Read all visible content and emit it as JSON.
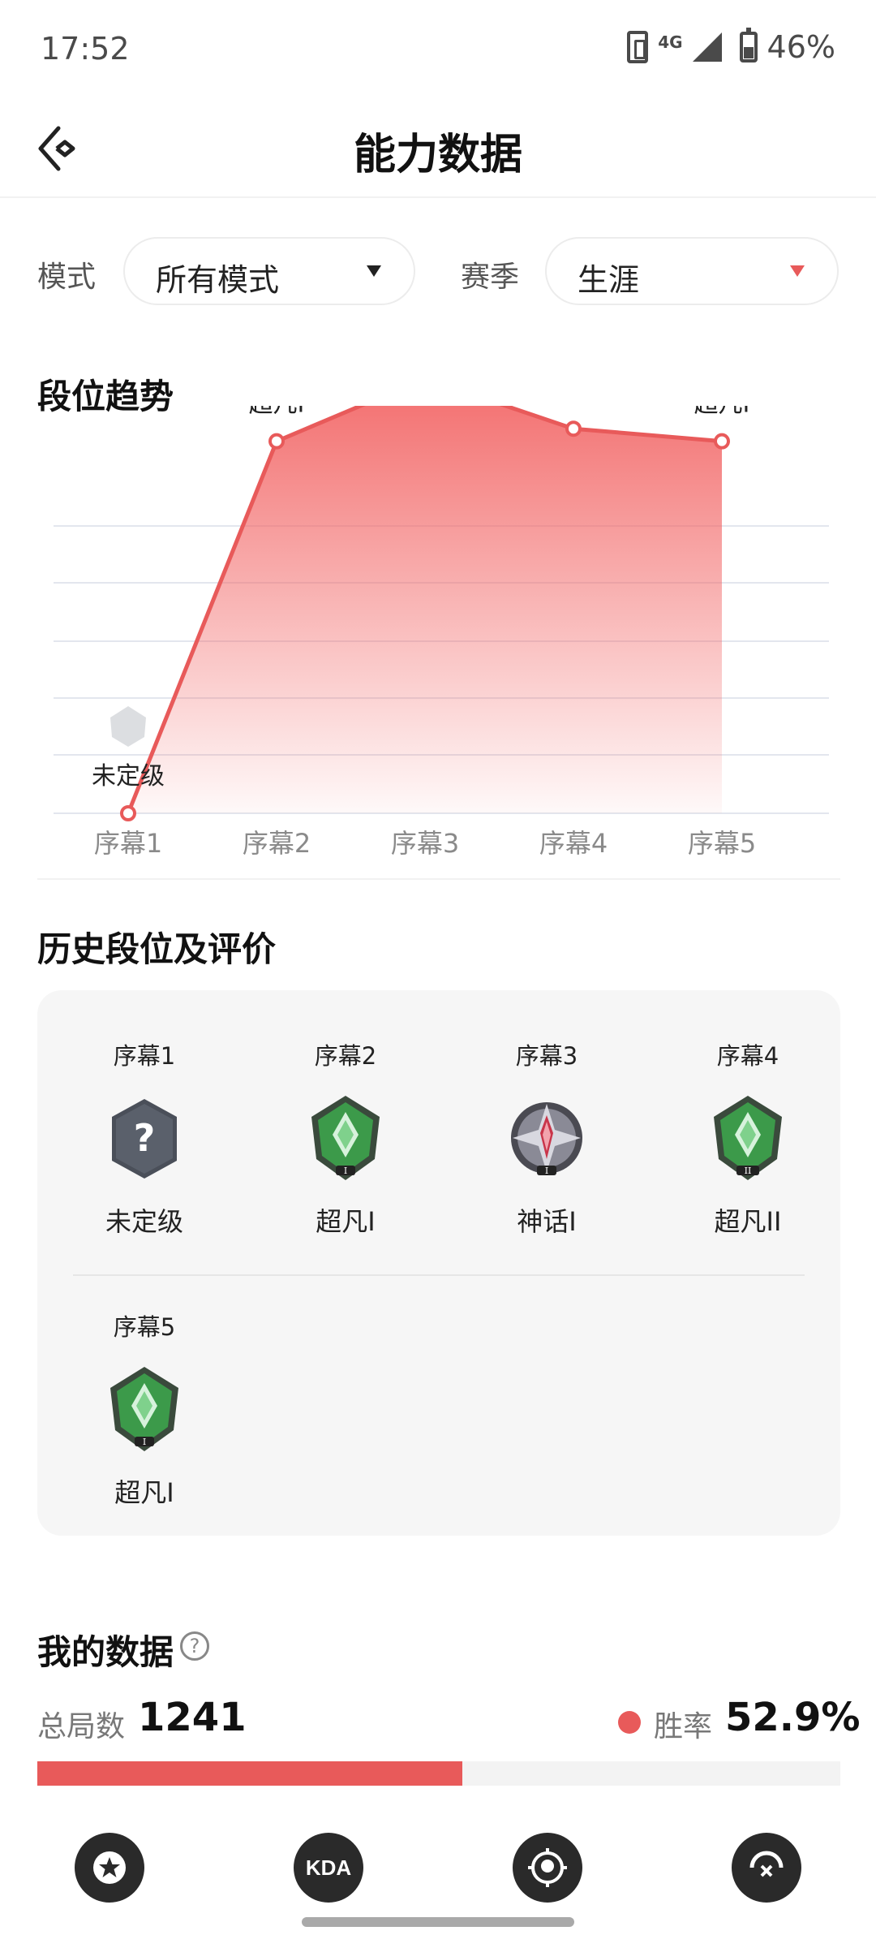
{
  "status_bar": {
    "time": "17:52",
    "network": "4G",
    "battery": "46%"
  },
  "header": {
    "title": "能力数据"
  },
  "filters": {
    "mode_label": "模式",
    "mode_value": "所有模式",
    "season_label": "赛季",
    "season_value": "生涯"
  },
  "trend": {
    "title": "段位趋势",
    "points": [
      {
        "act": "序幕1",
        "rank": "未定级",
        "level": 0,
        "badge": "unranked"
      },
      {
        "act": "序幕2",
        "rank": "超凡I",
        "level": 4.45,
        "badge": "immortal"
      },
      {
        "act": "序幕3",
        "rank": "神话I",
        "level": 5.2,
        "badge": "mythic"
      },
      {
        "act": "序幕4",
        "rank": "超凡II",
        "level": 4.6,
        "badge": "immortal"
      },
      {
        "act": "序幕5",
        "rank": "超凡I",
        "level": 4.45,
        "badge": "immortal"
      }
    ]
  },
  "history": {
    "title": "历史段位及评价",
    "items": [
      {
        "act": "序幕1",
        "rank": "未定级",
        "badge": "unranked-badge-icon"
      },
      {
        "act": "序幕2",
        "rank": "超凡I",
        "badge": "immortal-1-badge-icon"
      },
      {
        "act": "序幕3",
        "rank": "神话I",
        "badge": "mythic-1-badge-icon"
      },
      {
        "act": "序幕4",
        "rank": "超凡II",
        "badge": "immortal-2-badge-icon"
      },
      {
        "act": "序幕5",
        "rank": "超凡I",
        "badge": "immortal-1-badge-icon"
      }
    ]
  },
  "my_data": {
    "title": "我的数据",
    "help_icon": "?",
    "total_label": "总局数",
    "total_value": "1241",
    "win_label": "胜率",
    "win_value": "52.9%",
    "win_rate": 0.529
  },
  "nav": {
    "kda_label": "KDA",
    "icons": [
      "star-icon",
      "kda-icon",
      "target-icon",
      "crosshair-icon"
    ]
  },
  "colors": {
    "accent": "#e85a5a",
    "immortal": "#3c9a4a",
    "mythic": "#c9354a",
    "dark": "#2a2a2a"
  }
}
